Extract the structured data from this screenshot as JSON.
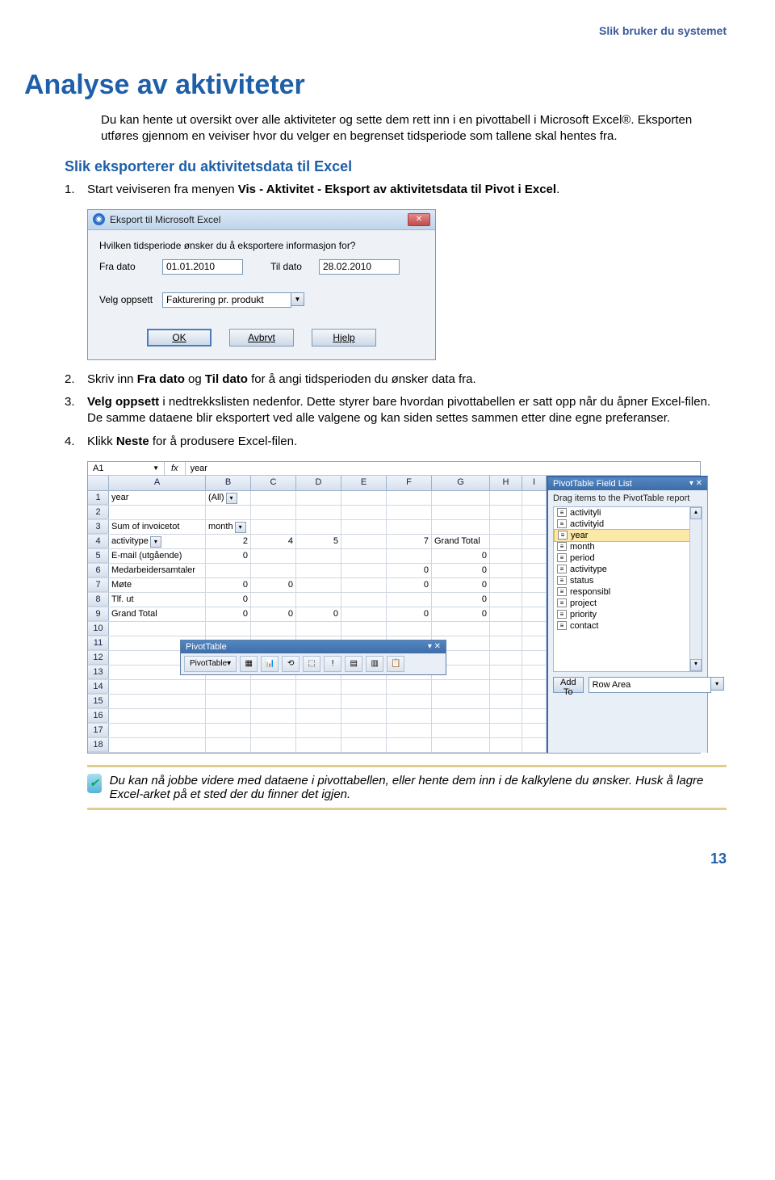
{
  "header_right": "Slik bruker du systemet",
  "h1": "Analyse av aktiviteter",
  "intro": "Du kan hente ut oversikt over alle aktiviteter og sette dem rett inn i en pivottabell i Microsoft Excel®. Eksporten utføres gjennom en veiviser hvor du velger en begrenset tidsperiode som tallene skal hentes fra.",
  "h2": "Slik eksporterer du aktivitetsdata til Excel",
  "steps": {
    "s1_pre": "Start veiviseren fra menyen ",
    "s1_b": "Vis - Aktivitet - Eksport av aktivitetsdata til Pivot i Excel",
    "s1_post": ".",
    "s2_pre": "Skriv inn ",
    "s2_b1": "Fra dato",
    "s2_mid": " og ",
    "s2_b2": "Til dato",
    "s2_post": " for å angi tidsperioden du ønsker data fra.",
    "s3_b": "Velg oppsett",
    "s3_post": " i nedtrekkslisten nedenfor. Dette styrer bare hvordan pivottabellen er satt opp når du åpner Excel-filen. De samme dataene blir eksportert ved alle valgene og kan siden settes sammen etter dine egne preferanser.",
    "s4_pre": "Klikk ",
    "s4_b": "Neste",
    "s4_post": " for å produsere Excel-filen."
  },
  "dialog": {
    "title": "Eksport til Microsoft Excel",
    "question": "Hvilken tidsperiode ønsker du å eksportere informasjon for?",
    "from_label": "Fra dato",
    "from_value": "01.01.2010",
    "to_label": "Til dato",
    "to_value": "28.02.2010",
    "layout_label": "Velg oppsett",
    "layout_value": "Fakturering pr. produkt",
    "ok": "OK",
    "cancel": "Avbryt",
    "help": "Hjelp"
  },
  "excel": {
    "namebox": "A1",
    "fx": "fx",
    "formula": "year",
    "cols": [
      "A",
      "B",
      "C",
      "D",
      "E",
      "F",
      "G",
      "H",
      "I"
    ],
    "rows": [
      {
        "n": "1",
        "A": "year",
        "B": "(All)",
        "hasFilterB": true
      },
      {
        "n": "2"
      },
      {
        "n": "3",
        "A": "Sum of invoicetot",
        "B": "month",
        "hasFilterB": true
      },
      {
        "n": "4",
        "A": "activitype",
        "hasFilterA": true,
        "B": "2",
        "C": "4",
        "D": "5",
        "E": "",
        "F": "7",
        "G": "Grand Total"
      },
      {
        "n": "5",
        "A": "E-mail (utgående)",
        "B": "0",
        "G": "0"
      },
      {
        "n": "6",
        "A": "Medarbeidersamtaler",
        "F": "0",
        "G": "0"
      },
      {
        "n": "7",
        "A": "Møte",
        "B": "0",
        "C": "0",
        "F": "0",
        "G": "0"
      },
      {
        "n": "8",
        "A": "Tlf. ut",
        "B": "0",
        "G": "0"
      },
      {
        "n": "9",
        "A": "Grand Total",
        "B": "0",
        "C": "0",
        "D": "0",
        "F": "0",
        "G": "0"
      },
      {
        "n": "10"
      },
      {
        "n": "11"
      },
      {
        "n": "12"
      },
      {
        "n": "13"
      },
      {
        "n": "14"
      },
      {
        "n": "15"
      },
      {
        "n": "16"
      },
      {
        "n": "17"
      },
      {
        "n": "18"
      }
    ],
    "pivotToolbar": {
      "title": "PivotTable",
      "label": "PivotTable"
    },
    "fieldList": {
      "title": "PivotTable Field List",
      "hint": "Drag items to the PivotTable report",
      "items": [
        "activityli",
        "activityid",
        "year",
        "month",
        "period",
        "activitype",
        "status",
        "responsibl",
        "project",
        "priority",
        "contact"
      ],
      "selectedIndex": 2,
      "addTo": "Add To",
      "area": "Row Area"
    }
  },
  "note": "Du kan nå jobbe videre med dataene i pivottabellen, eller hente dem inn i de kalkylene du ønsker. Husk å lagre Excel-arket på et sted der du finner det igjen.",
  "page_num": "13"
}
